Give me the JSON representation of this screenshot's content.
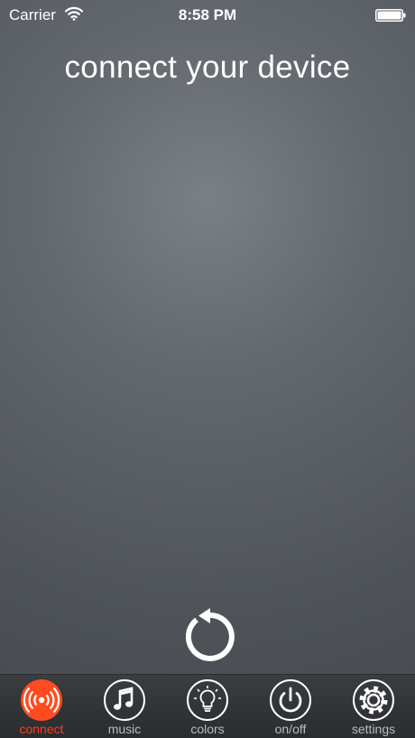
{
  "status_bar": {
    "carrier": "Carrier",
    "time": "8:58 PM"
  },
  "main": {
    "title": "connect your device",
    "refresh_icon": "refresh-icon"
  },
  "tab_bar": {
    "active_color": "#ff4b1f",
    "tabs": [
      {
        "label": "connect",
        "icon": "broadcast-icon",
        "active": true
      },
      {
        "label": "music",
        "icon": "music-note-icon",
        "active": false
      },
      {
        "label": "colors",
        "icon": "lightbulb-icon",
        "active": false
      },
      {
        "label": "on/off",
        "icon": "power-icon",
        "active": false
      },
      {
        "label": "settings",
        "icon": "gear-icon",
        "active": false
      }
    ]
  }
}
